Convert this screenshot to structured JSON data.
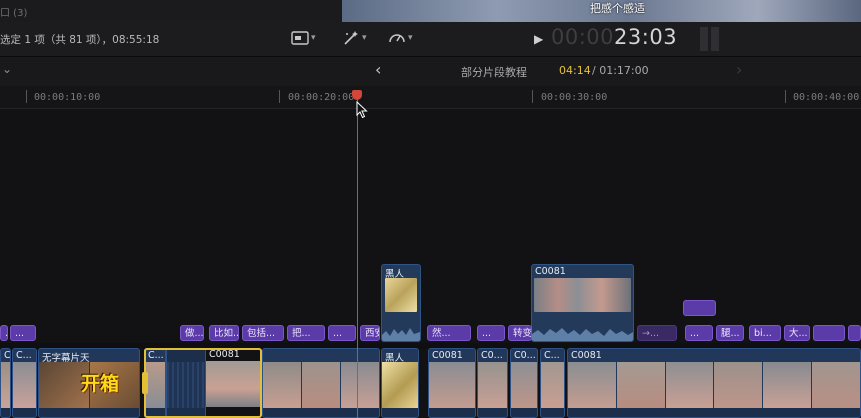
{
  "top_strip": {
    "fragment": "口  (3)",
    "viewer_caption": "把感个感适"
  },
  "toolbar": {
    "selection_info": "选定 1 项（共 81 项），08:55:18",
    "icons": [
      "clip-appearance-icon",
      "magic-wand-icon",
      "speedometer-icon"
    ],
    "timecode_dim": "00:00",
    "timecode_bright": "23:03"
  },
  "project_bar": {
    "name": "部分片段教程",
    "position": "04:14",
    "duration": "/ 01:17:00"
  },
  "ruler": {
    "labels": [
      "00:00:10:00",
      "00:00:20:00",
      "00:00:30:00",
      "00:00:40:00"
    ]
  },
  "connected_clips": [
    {
      "label": "黑人"
    },
    {
      "label": "C0081"
    },
    {
      "label": ""
    }
  ],
  "titles": [
    "...",
    "...",
    "做...",
    "比如...",
    "包括...",
    "把...",
    "...",
    "西安...",
    "然...",
    "...",
    "转变...",
    "→...",
    "...",
    "腿...",
    "bi...",
    "大...",
    ""
  ],
  "primary_storyline": [
    {
      "label": "C0"
    },
    {
      "label": "C..."
    },
    {
      "label": "无字幕片天",
      "overlay": "开箱"
    },
    {
      "label": "C..."
    },
    {
      "label": "C0081"
    },
    {
      "label": ""
    },
    {
      "label": "黑人"
    },
    {
      "label": "C0081"
    },
    {
      "label": "C0..."
    },
    {
      "label": "C0..."
    },
    {
      "label": "C..."
    },
    {
      "label": "C0081"
    }
  ]
}
